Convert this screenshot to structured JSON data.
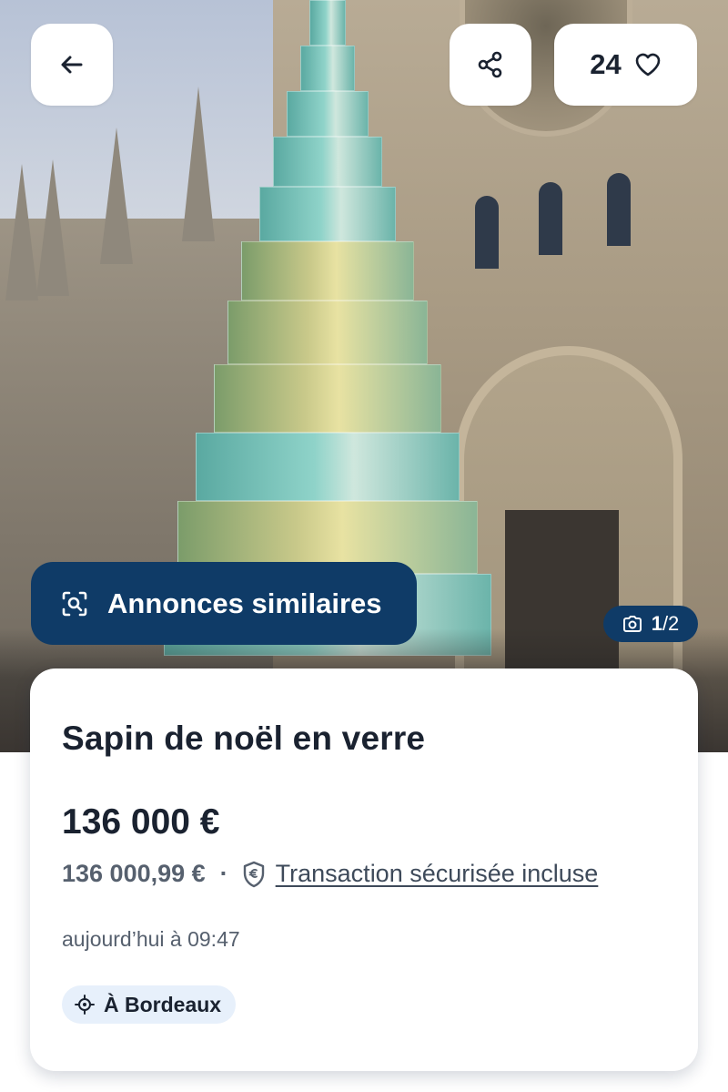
{
  "header": {
    "favorites_count": "24"
  },
  "hero": {
    "similar_button_label": "Annonces similaires",
    "photo_counter_current": "1",
    "photo_counter_total": "/2"
  },
  "listing": {
    "title": "Sapin de noël en verre",
    "price": "136 000 €",
    "secure_price": "136 000,99 €",
    "separator": "·",
    "secure_link_label": "Transaction sécurisée incluse",
    "date": "aujourd’hui à 09:47",
    "location": "À Bordeaux"
  },
  "icons": {
    "back": "arrow-left-icon",
    "share": "share-icon",
    "favorite": "heart-outline-icon",
    "similar": "search-image-icon",
    "camera": "camera-icon",
    "shield": "shield-euro-icon",
    "location": "location-target-icon"
  },
  "colors": {
    "brand_navy": "#0f3b67",
    "text_primary": "#1a2230",
    "text_secondary": "#56606e",
    "location_badge_bg": "#e7f0fb",
    "card_bg": "#ffffff"
  }
}
